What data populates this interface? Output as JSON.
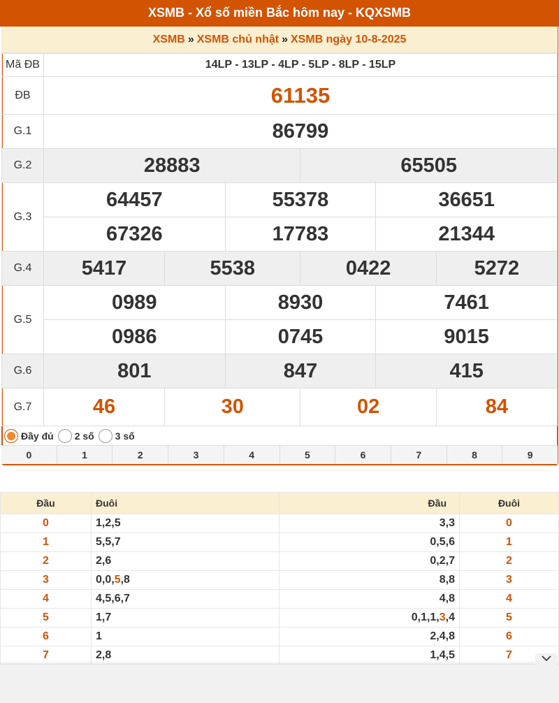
{
  "header": {
    "title": "XSMB - Xổ số miền Bắc hôm nay - KQXSMB"
  },
  "breadcrumb": {
    "item1": "XSMB",
    "sep": "»",
    "item2": "XSMB chủ nhật",
    "item3": "XSMB ngày 10-8-2025"
  },
  "results": {
    "ma_db_label": "Mã ĐB",
    "ma_db_value": "14LP - 13LP - 4LP - 5LP - 8LP - 15LP",
    "db_label": "ĐB",
    "db": "61135",
    "g1_label": "G.1",
    "g1": "86799",
    "g2_label": "G.2",
    "g2": [
      "28883",
      "65505"
    ],
    "g3_label": "G.3",
    "g3": [
      "64457",
      "55378",
      "36651",
      "67326",
      "17783",
      "21344"
    ],
    "g4_label": "G.4",
    "g4": [
      "5417",
      "5538",
      "0422",
      "5272"
    ],
    "g5_label": "G.5",
    "g5": [
      "0989",
      "8930",
      "7461",
      "0986",
      "0745",
      "9015"
    ],
    "g6_label": "G.6",
    "g6": [
      "801",
      "847",
      "415"
    ],
    "g7_label": "G.7",
    "g7": [
      "46",
      "30",
      "02",
      "84"
    ]
  },
  "options": {
    "full": "Đầy đủ",
    "two": "2 số",
    "three": "3 số"
  },
  "digits": [
    "0",
    "1",
    "2",
    "3",
    "4",
    "5",
    "6",
    "7",
    "8",
    "9"
  ],
  "loto": {
    "headers": {
      "dau": "Đầu",
      "duoi": "Đuôi",
      "dau2": "Đầu",
      "duoi2": "Đuôi"
    },
    "rows": [
      {
        "dau": "0",
        "duoi_a": "1,2,5",
        "duoi_hl": "",
        "duoi_b": "",
        "dau2_a": "3,3",
        "dau2_hl": "",
        "dau2_b": "",
        "duoi2": "0"
      },
      {
        "dau": "1",
        "duoi_a": "5,5,7",
        "duoi_hl": "",
        "duoi_b": "",
        "dau2_a": "0,5,6",
        "dau2_hl": "",
        "dau2_b": "",
        "duoi2": "1"
      },
      {
        "dau": "2",
        "duoi_a": "2,6",
        "duoi_hl": "",
        "duoi_b": "",
        "dau2_a": "0,2,7",
        "dau2_hl": "",
        "dau2_b": "",
        "duoi2": "2"
      },
      {
        "dau": "3",
        "duoi_a": "0,0,",
        "duoi_hl": "5",
        "duoi_b": ",8",
        "dau2_a": "8,8",
        "dau2_hl": "",
        "dau2_b": "",
        "duoi2": "3"
      },
      {
        "dau": "4",
        "duoi_a": "4,5,6,7",
        "duoi_hl": "",
        "duoi_b": "",
        "dau2_a": "4,8",
        "dau2_hl": "",
        "dau2_b": "",
        "duoi2": "4"
      },
      {
        "dau": "5",
        "duoi_a": "1,7",
        "duoi_hl": "",
        "duoi_b": "",
        "dau2_a": "0,1,1,",
        "dau2_hl": "3",
        "dau2_b": ",4",
        "duoi2": "5"
      },
      {
        "dau": "6",
        "duoi_a": "1",
        "duoi_hl": "",
        "duoi_b": "",
        "dau2_a": "2,4,8",
        "dau2_hl": "",
        "dau2_b": "",
        "duoi2": "6"
      },
      {
        "dau": "7",
        "duoi_a": "2,8",
        "duoi_hl": "",
        "duoi_b": "",
        "dau2_a": "1,4,5",
        "dau2_hl": "",
        "dau2_b": "",
        "duoi2": "7"
      }
    ]
  },
  "icons": {
    "collapse": "chevron-down-icon"
  },
  "colors": {
    "accent": "#d25301",
    "header_bg": "#fbefd1",
    "link": "#0067b8"
  }
}
